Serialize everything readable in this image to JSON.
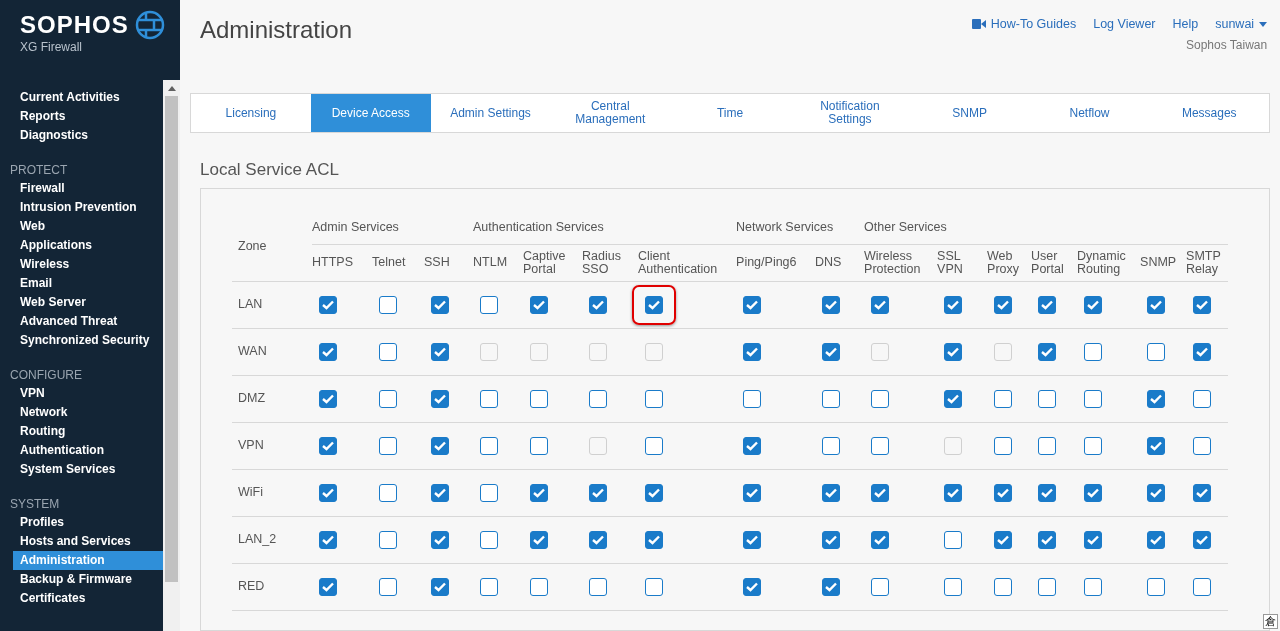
{
  "brand": {
    "name": "SOPHOS",
    "product": "XG Firewall"
  },
  "sidebar": {
    "items": [
      {
        "label": "Current Activities",
        "selected": false
      },
      {
        "label": "Reports",
        "selected": false
      },
      {
        "label": "Diagnostics",
        "selected": false
      }
    ],
    "sections": [
      {
        "title": "PROTECT",
        "items": [
          {
            "label": "Firewall",
            "selected": false
          },
          {
            "label": "Intrusion Prevention",
            "selected": false
          },
          {
            "label": "Web",
            "selected": false
          },
          {
            "label": "Applications",
            "selected": false
          },
          {
            "label": "Wireless",
            "selected": false
          },
          {
            "label": "Email",
            "selected": false
          },
          {
            "label": "Web Server",
            "selected": false
          },
          {
            "label": "Advanced Threat",
            "selected": false
          },
          {
            "label": "Synchronized Security",
            "selected": false
          }
        ]
      },
      {
        "title": "CONFIGURE",
        "items": [
          {
            "label": "VPN",
            "selected": false
          },
          {
            "label": "Network",
            "selected": false
          },
          {
            "label": "Routing",
            "selected": false
          },
          {
            "label": "Authentication",
            "selected": false
          },
          {
            "label": "System Services",
            "selected": false
          }
        ]
      },
      {
        "title": "SYSTEM",
        "items": [
          {
            "label": "Profiles",
            "selected": false
          },
          {
            "label": "Hosts and Services",
            "selected": false
          },
          {
            "label": "Administration",
            "selected": true
          },
          {
            "label": "Backup & Firmware",
            "selected": false
          },
          {
            "label": "Certificates",
            "selected": false
          }
        ]
      }
    ]
  },
  "page_title": "Administration",
  "header_links": [
    "How-To Guides",
    "Log Viewer",
    "Help"
  ],
  "user": {
    "name": "sunwai",
    "organization": "Sophos Taiwan"
  },
  "tabs": [
    {
      "label": "Licensing",
      "selected": false
    },
    {
      "label": "Device Access",
      "selected": true
    },
    {
      "label": "Admin Settings",
      "selected": false
    },
    {
      "label": "Central Management",
      "selected": false
    },
    {
      "label": "Time",
      "selected": false
    },
    {
      "label": "Notification Settings",
      "selected": false
    },
    {
      "label": "SNMP",
      "selected": false
    },
    {
      "label": "Netflow",
      "selected": false
    },
    {
      "label": "Messages",
      "selected": false
    }
  ],
  "section_title": "Local Service ACL",
  "table": {
    "zone_header": "Zone",
    "groups": [
      {
        "label": "Admin Services",
        "columns": [
          "HTTPS",
          "Telnet",
          "SSH"
        ]
      },
      {
        "label": "Authentication Services",
        "columns": [
          "NTLM",
          "Captive Portal",
          "Radius SSO",
          "Client Authentication"
        ]
      },
      {
        "label": "Network Services",
        "columns": [
          "Ping/Ping6",
          "DNS"
        ]
      },
      {
        "label": "Other Services",
        "columns": [
          "Wireless Protection",
          "SSL VPN",
          "Web Proxy",
          "User Portal",
          "Dynamic Routing",
          "SNMP",
          "SMTP Relay"
        ]
      }
    ],
    "rows": [
      {
        "zone": "LAN",
        "cells": [
          {
            "checked": true,
            "disabled": false,
            "highlighted": false
          },
          {
            "checked": false,
            "disabled": false,
            "highlighted": false
          },
          {
            "checked": true,
            "disabled": false,
            "highlighted": false
          },
          {
            "checked": false,
            "disabled": false,
            "highlighted": false
          },
          {
            "checked": true,
            "disabled": false,
            "highlighted": false
          },
          {
            "checked": true,
            "disabled": false,
            "highlighted": false
          },
          {
            "checked": true,
            "disabled": false,
            "highlighted": true
          },
          {
            "checked": true,
            "disabled": false,
            "highlighted": false
          },
          {
            "checked": true,
            "disabled": false,
            "highlighted": false
          },
          {
            "checked": true,
            "disabled": false,
            "highlighted": false
          },
          {
            "checked": true,
            "disabled": false,
            "highlighted": false
          },
          {
            "checked": true,
            "disabled": false,
            "highlighted": false
          },
          {
            "checked": true,
            "disabled": false,
            "highlighted": false
          },
          {
            "checked": true,
            "disabled": false,
            "highlighted": false
          },
          {
            "checked": true,
            "disabled": false,
            "highlighted": false
          },
          {
            "checked": true,
            "disabled": false,
            "highlighted": false
          }
        ]
      },
      {
        "zone": "WAN",
        "cells": [
          {
            "checked": true,
            "disabled": false,
            "highlighted": false
          },
          {
            "checked": false,
            "disabled": false,
            "highlighted": false
          },
          {
            "checked": true,
            "disabled": false,
            "highlighted": false
          },
          {
            "checked": false,
            "disabled": true,
            "highlighted": false
          },
          {
            "checked": false,
            "disabled": true,
            "highlighted": false
          },
          {
            "checked": false,
            "disabled": true,
            "highlighted": false
          },
          {
            "checked": false,
            "disabled": true,
            "highlighted": false
          },
          {
            "checked": true,
            "disabled": false,
            "highlighted": false
          },
          {
            "checked": true,
            "disabled": false,
            "highlighted": false
          },
          {
            "checked": false,
            "disabled": true,
            "highlighted": false
          },
          {
            "checked": true,
            "disabled": false,
            "highlighted": false
          },
          {
            "checked": false,
            "disabled": true,
            "highlighted": false
          },
          {
            "checked": true,
            "disabled": false,
            "highlighted": false
          },
          {
            "checked": false,
            "disabled": false,
            "highlighted": false
          },
          {
            "checked": false,
            "disabled": false,
            "highlighted": false
          },
          {
            "checked": true,
            "disabled": false,
            "highlighted": false
          }
        ]
      },
      {
        "zone": "DMZ",
        "cells": [
          {
            "checked": true,
            "disabled": false,
            "highlighted": false
          },
          {
            "checked": false,
            "disabled": false,
            "highlighted": false
          },
          {
            "checked": true,
            "disabled": false,
            "highlighted": false
          },
          {
            "checked": false,
            "disabled": false,
            "highlighted": false
          },
          {
            "checked": false,
            "disabled": false,
            "highlighted": false
          },
          {
            "checked": false,
            "disabled": false,
            "highlighted": false
          },
          {
            "checked": false,
            "disabled": false,
            "highlighted": false
          },
          {
            "checked": false,
            "disabled": false,
            "highlighted": false
          },
          {
            "checked": false,
            "disabled": false,
            "highlighted": false
          },
          {
            "checked": false,
            "disabled": false,
            "highlighted": false
          },
          {
            "checked": true,
            "disabled": false,
            "highlighted": false
          },
          {
            "checked": false,
            "disabled": false,
            "highlighted": false
          },
          {
            "checked": false,
            "disabled": false,
            "highlighted": false
          },
          {
            "checked": false,
            "disabled": false,
            "highlighted": false
          },
          {
            "checked": true,
            "disabled": false,
            "highlighted": false
          },
          {
            "checked": false,
            "disabled": false,
            "highlighted": false
          }
        ]
      },
      {
        "zone": "VPN",
        "cells": [
          {
            "checked": true,
            "disabled": false,
            "highlighted": false
          },
          {
            "checked": false,
            "disabled": false,
            "highlighted": false
          },
          {
            "checked": true,
            "disabled": false,
            "highlighted": false
          },
          {
            "checked": false,
            "disabled": false,
            "highlighted": false
          },
          {
            "checked": false,
            "disabled": false,
            "highlighted": false
          },
          {
            "checked": false,
            "disabled": true,
            "highlighted": false
          },
          {
            "checked": false,
            "disabled": false,
            "highlighted": false
          },
          {
            "checked": true,
            "disabled": false,
            "highlighted": false
          },
          {
            "checked": false,
            "disabled": false,
            "highlighted": false
          },
          {
            "checked": false,
            "disabled": false,
            "highlighted": false
          },
          {
            "checked": false,
            "disabled": true,
            "highlighted": false
          },
          {
            "checked": false,
            "disabled": false,
            "highlighted": false
          },
          {
            "checked": false,
            "disabled": false,
            "highlighted": false
          },
          {
            "checked": false,
            "disabled": false,
            "highlighted": false
          },
          {
            "checked": true,
            "disabled": false,
            "highlighted": false
          },
          {
            "checked": false,
            "disabled": false,
            "highlighted": false
          }
        ]
      },
      {
        "zone": "WiFi",
        "cells": [
          {
            "checked": true,
            "disabled": false,
            "highlighted": false
          },
          {
            "checked": false,
            "disabled": false,
            "highlighted": false
          },
          {
            "checked": true,
            "disabled": false,
            "highlighted": false
          },
          {
            "checked": false,
            "disabled": false,
            "highlighted": false
          },
          {
            "checked": true,
            "disabled": false,
            "highlighted": false
          },
          {
            "checked": true,
            "disabled": false,
            "highlighted": false
          },
          {
            "checked": true,
            "disabled": false,
            "highlighted": false
          },
          {
            "checked": true,
            "disabled": false,
            "highlighted": false
          },
          {
            "checked": true,
            "disabled": false,
            "highlighted": false
          },
          {
            "checked": true,
            "disabled": false,
            "highlighted": false
          },
          {
            "checked": true,
            "disabled": false,
            "highlighted": false
          },
          {
            "checked": true,
            "disabled": false,
            "highlighted": false
          },
          {
            "checked": true,
            "disabled": false,
            "highlighted": false
          },
          {
            "checked": true,
            "disabled": false,
            "highlighted": false
          },
          {
            "checked": true,
            "disabled": false,
            "highlighted": false
          },
          {
            "checked": true,
            "disabled": false,
            "highlighted": false
          }
        ]
      },
      {
        "zone": "LAN_2",
        "cells": [
          {
            "checked": true,
            "disabled": false,
            "highlighted": false
          },
          {
            "checked": false,
            "disabled": false,
            "highlighted": false
          },
          {
            "checked": true,
            "disabled": false,
            "highlighted": false
          },
          {
            "checked": false,
            "disabled": false,
            "highlighted": false
          },
          {
            "checked": true,
            "disabled": false,
            "highlighted": false
          },
          {
            "checked": true,
            "disabled": false,
            "highlighted": false
          },
          {
            "checked": true,
            "disabled": false,
            "highlighted": false
          },
          {
            "checked": true,
            "disabled": false,
            "highlighted": false
          },
          {
            "checked": true,
            "disabled": false,
            "highlighted": false
          },
          {
            "checked": true,
            "disabled": false,
            "highlighted": false
          },
          {
            "checked": false,
            "disabled": false,
            "highlighted": false
          },
          {
            "checked": true,
            "disabled": false,
            "highlighted": false
          },
          {
            "checked": true,
            "disabled": false,
            "highlighted": false
          },
          {
            "checked": true,
            "disabled": false,
            "highlighted": false
          },
          {
            "checked": true,
            "disabled": false,
            "highlighted": false
          },
          {
            "checked": true,
            "disabled": false,
            "highlighted": false
          }
        ]
      },
      {
        "zone": "RED",
        "cells": [
          {
            "checked": true,
            "disabled": false,
            "highlighted": false
          },
          {
            "checked": false,
            "disabled": false,
            "highlighted": false
          },
          {
            "checked": true,
            "disabled": false,
            "highlighted": false
          },
          {
            "checked": false,
            "disabled": false,
            "highlighted": false
          },
          {
            "checked": false,
            "disabled": false,
            "highlighted": false
          },
          {
            "checked": false,
            "disabled": false,
            "highlighted": false
          },
          {
            "checked": false,
            "disabled": false,
            "highlighted": false
          },
          {
            "checked": true,
            "disabled": false,
            "highlighted": false
          },
          {
            "checked": true,
            "disabled": false,
            "highlighted": false
          },
          {
            "checked": false,
            "disabled": false,
            "highlighted": false
          },
          {
            "checked": false,
            "disabled": false,
            "highlighted": false
          },
          {
            "checked": false,
            "disabled": false,
            "highlighted": false
          },
          {
            "checked": false,
            "disabled": false,
            "highlighted": false
          },
          {
            "checked": false,
            "disabled": false,
            "highlighted": false
          },
          {
            "checked": false,
            "disabled": false,
            "highlighted": false
          },
          {
            "checked": false,
            "disabled": false,
            "highlighted": false
          }
        ]
      }
    ]
  },
  "ime_indicator": "倉"
}
